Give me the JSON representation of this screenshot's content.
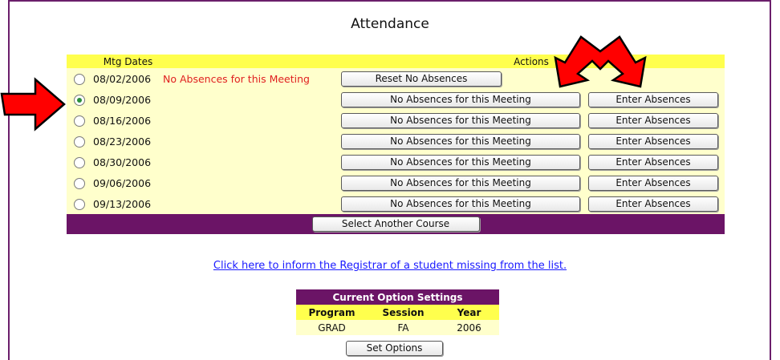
{
  "page": {
    "title": "Attendance"
  },
  "table": {
    "col_dates": "Mtg Dates",
    "col_actions": "Actions",
    "rows": [
      {
        "date": "08/02/2006",
        "checked": false,
        "status": "No Absences for this Meeting",
        "reset_label": "Reset No Absences"
      },
      {
        "date": "08/09/2006",
        "checked": true,
        "noabs_label": "No Absences for this Meeting",
        "enter_label": "Enter Absences"
      },
      {
        "date": "08/16/2006",
        "checked": false,
        "noabs_label": "No Absences for this Meeting",
        "enter_label": "Enter Absences"
      },
      {
        "date": "08/23/2006",
        "checked": false,
        "noabs_label": "No Absences for this Meeting",
        "enter_label": "Enter Absences"
      },
      {
        "date": "08/30/2006",
        "checked": false,
        "noabs_label": "No Absences for this Meeting",
        "enter_label": "Enter Absences"
      },
      {
        "date": "09/06/2006",
        "checked": false,
        "noabs_label": "No Absences for this Meeting",
        "enter_label": "Enter Absences"
      },
      {
        "date": "09/13/2006",
        "checked": false,
        "noabs_label": "No Absences for this Meeting",
        "enter_label": "Enter Absences"
      }
    ],
    "select_course_label": "Select Another Course"
  },
  "registrar_link": "Click here to inform the Registrar of a student missing from the list.",
  "options": {
    "title": "Current Option Settings",
    "headers": [
      "Program",
      "Session",
      "Year"
    ],
    "values": [
      "GRAD",
      "FA",
      "2006"
    ],
    "set_label": "Set Options"
  },
  "colors": {
    "accent_purple": "#6b1466",
    "header_yellow": "#ffff4d",
    "row_yellow": "#ffffcc",
    "alert_red": "#e02020",
    "arrow_red": "#ff0000"
  },
  "annotations": {
    "arrows": [
      "left-arrow-icon",
      "double-arrow-icon"
    ]
  }
}
